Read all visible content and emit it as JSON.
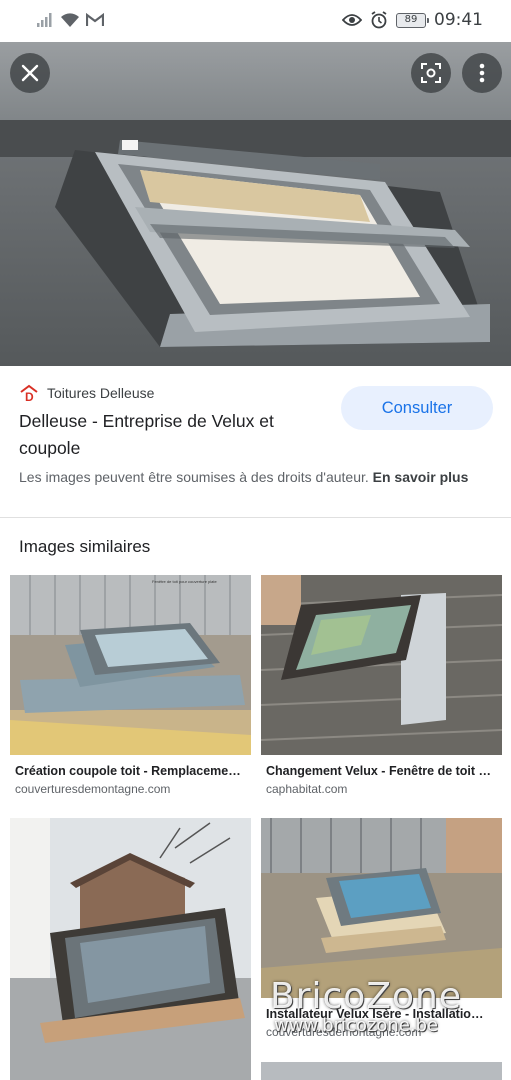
{
  "status_bar": {
    "time": "09:41",
    "battery": "89",
    "icons": [
      "signal-icon",
      "wifi-icon",
      "gmail-icon",
      "eye-icon",
      "alarm-icon"
    ]
  },
  "hero": {
    "subject": "skylight-on-flat-roof"
  },
  "source": {
    "site_name": "Toitures Delleuse",
    "title": "Delleuse - Entreprise de Velux et coupole",
    "button": "Consulter",
    "copyright_text": "Les images peuvent être soumises à des droits d'auteur.",
    "learn_more": "En savoir plus"
  },
  "similar": {
    "heading": "Images similaires",
    "items": [
      {
        "title": "Création coupole toit - Remplaceme…",
        "site": "couverturesdemontagne.com",
        "photo_text": "Fenêtre de toit pour couverture plate"
      },
      {
        "title": "Changement Velux - Fenêtre de toit …",
        "site": "caphabitat.com"
      },
      {
        "title": "",
        "site": ""
      },
      {
        "title": "Installateur Velux Isère - Installatio…",
        "site": "couverturesdemontagne.com"
      }
    ]
  },
  "watermark": {
    "logo": "BricoZone",
    "url": "www.bricozone.be"
  },
  "colors": {
    "accent": "#1a73e8",
    "button_bg": "#e8f0fe",
    "brand_red": "#d93025"
  }
}
